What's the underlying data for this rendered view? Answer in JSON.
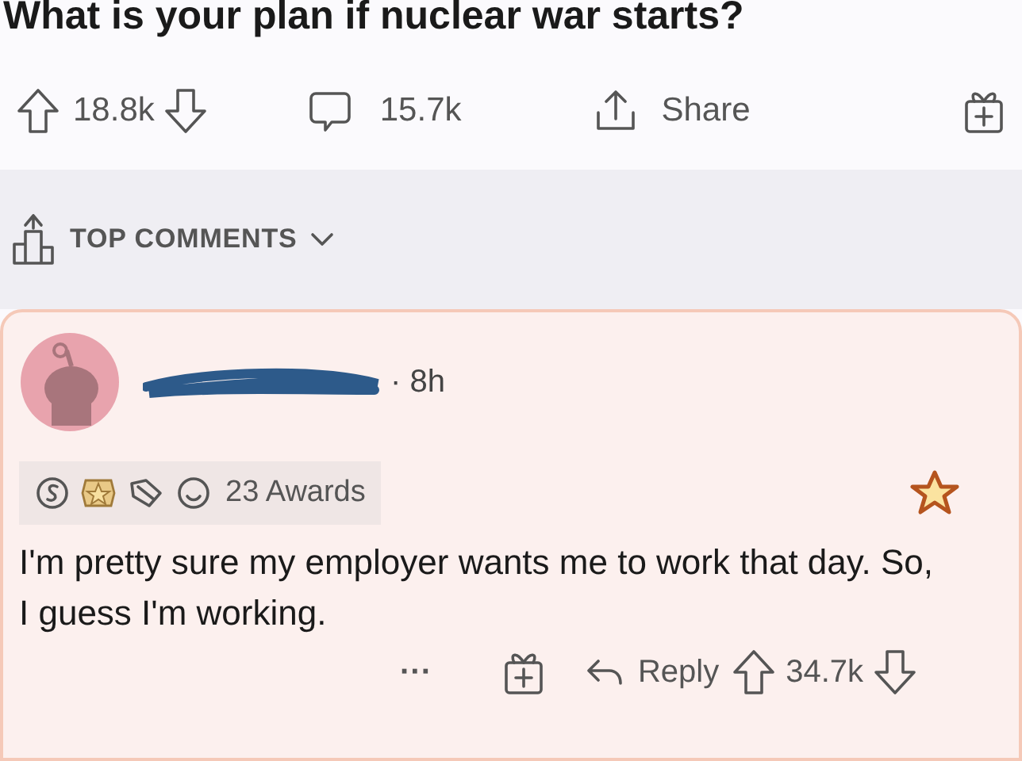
{
  "post": {
    "title": "What is your plan if nuclear war starts?",
    "votes": "18.8k",
    "comments": "15.7k",
    "share": "Share"
  },
  "sort": {
    "label": "TOP COMMENTS"
  },
  "comment": {
    "time": "· 8h",
    "awards": "23 Awards",
    "body": "I'm pretty sure my employer wants me to work that day. So, I guess I'm working.",
    "more": "···",
    "reply": "Reply",
    "votes": "34.7k"
  }
}
